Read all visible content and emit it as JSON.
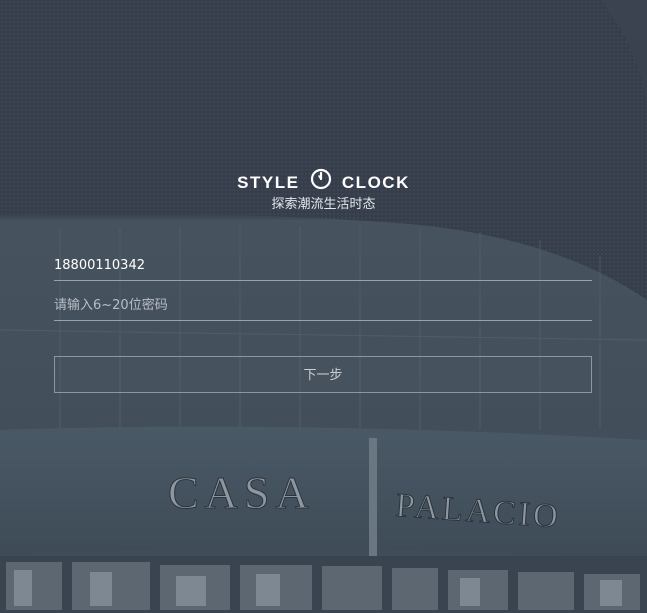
{
  "brand": {
    "left_word": "STYLE",
    "right_word": "CLOCK"
  },
  "tagline": "探索潮流生活时态",
  "form": {
    "phone_value": "18800110342",
    "password_placeholder": "请输入6~20位密码",
    "next_label": "下一步"
  },
  "background": {
    "sign_left": "CASA",
    "sign_right": "PALACIO"
  }
}
